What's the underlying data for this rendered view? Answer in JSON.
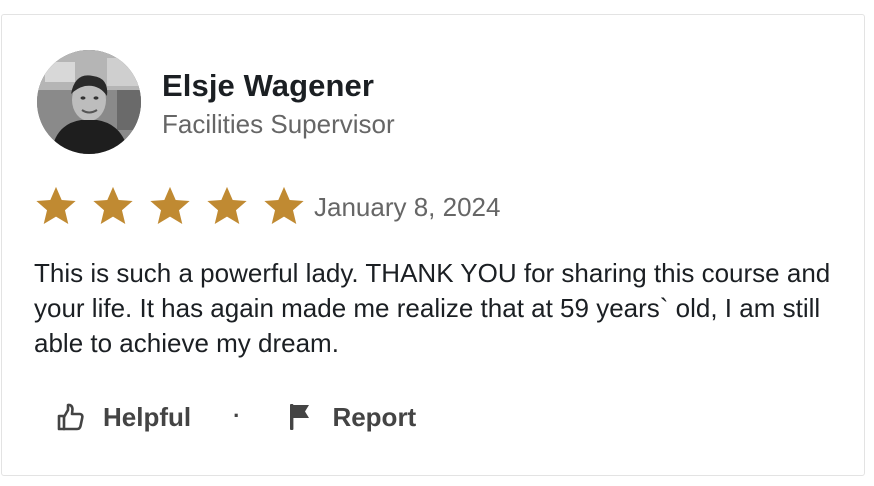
{
  "review": {
    "author_name": "Elsje Wagener",
    "author_title": "Facilities Supervisor",
    "avatar_icon": "user-photo",
    "rating": 5,
    "rating_max": 5,
    "star_color": "#c08a32",
    "date": "January 8, 2024",
    "text": "This is such a powerful lady. THANK YOU for sharing this course and your life. It has again made me realize that at 59 years` old, I am still able to achieve my dream."
  },
  "actions": {
    "helpful_label": "Helpful",
    "helpful_icon": "thumbs-up-icon",
    "separator": "·",
    "report_label": "Report",
    "report_icon": "flag-icon"
  }
}
